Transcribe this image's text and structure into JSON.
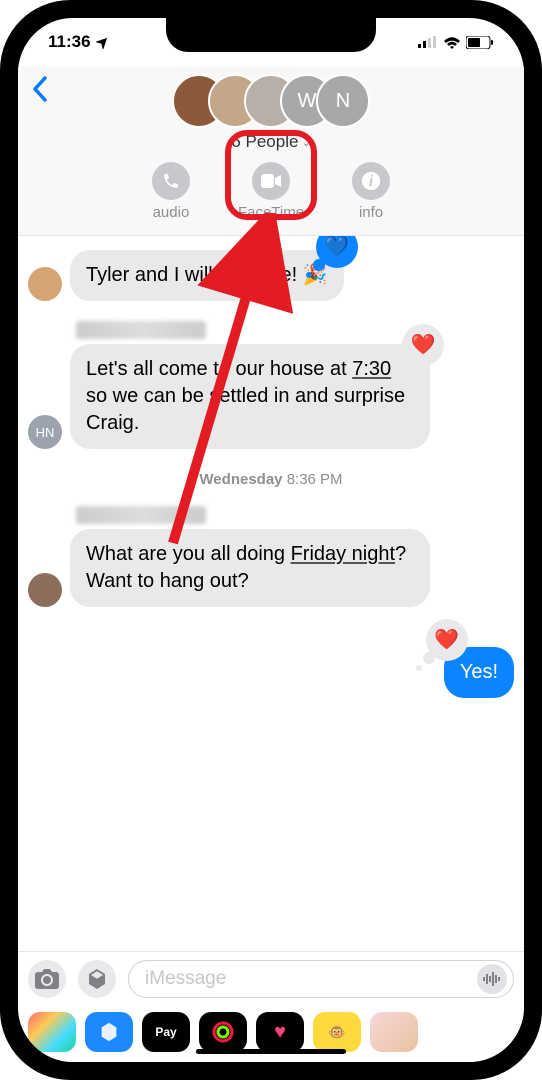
{
  "status": {
    "time": "11:36",
    "location_icon": "location-arrow",
    "signal": "signal-icon",
    "wifi": "wifi-icon",
    "battery": "battery-icon"
  },
  "header": {
    "back_icon": "chevron-left",
    "group_title": "6 People",
    "chevron": "chevron-down",
    "avatars": [
      {
        "color": "#8b5a3c",
        "initials": ""
      },
      {
        "color": "#c4a688",
        "initials": ""
      },
      {
        "color": "#b8b0a8",
        "initials": ""
      },
      {
        "color": "#a8a8a8",
        "initials": "W"
      },
      {
        "color": "#a8a8a8",
        "initials": "N"
      }
    ],
    "actions": {
      "audio": {
        "label": "audio",
        "icon": "phone"
      },
      "facetime": {
        "label": "FaceTime",
        "icon": "video"
      },
      "info": {
        "label": "info",
        "icon": "info"
      }
    }
  },
  "messages": [
    {
      "type": "in",
      "avatar_color": "#d4a574",
      "text": "Tyler and I will be there! 🎉",
      "reaction": {
        "emoji": "💙",
        "style": "blue",
        "side": "right"
      }
    },
    {
      "type": "in",
      "avatar_color": "#9ca3af",
      "avatar_initials": "HN",
      "text": "Let's all come to our house at 7:30 so we can be settled in and surprise Craig.",
      "sender_blur": true,
      "reaction": {
        "emoji": "❤️",
        "style": "grey",
        "side": "right"
      }
    },
    {
      "type": "timestamp",
      "day": "Wednesday",
      "time": "8:36 PM"
    },
    {
      "type": "in",
      "avatar_color": "#8b6f5c",
      "text": "What are you all doing Friday night? Want to hang out?",
      "sender_blur": true
    },
    {
      "type": "out",
      "text": "Yes!",
      "reaction": {
        "emoji": "❤️",
        "style": "grey",
        "side": "left"
      }
    }
  ],
  "input": {
    "camera_icon": "camera",
    "appstore_icon": "appstore",
    "placeholder": "iMessage",
    "mic_icon": "mic-waveform"
  },
  "tray": [
    {
      "name": "photos",
      "bg": "linear-gradient(135deg,#ff6b6b,#feca57,#48dbfb,#1dd1a1)"
    },
    {
      "name": "appstore",
      "bg": "#1e88ff",
      "icon": "A"
    },
    {
      "name": "applepay",
      "bg": "#000",
      "label": "Pay"
    },
    {
      "name": "activity",
      "bg": "#000",
      "icon": "◉"
    },
    {
      "name": "health",
      "bg": "#000",
      "icon": "❤"
    },
    {
      "name": "animoji",
      "bg": "#ffd93d",
      "icon": "🐵"
    },
    {
      "name": "memoji",
      "bg": "linear-gradient(135deg,#f8d7da,#e8c4a0)"
    }
  ],
  "annotation": {
    "highlight_target": "facetime-button",
    "arrow_color": "#e31b23"
  }
}
